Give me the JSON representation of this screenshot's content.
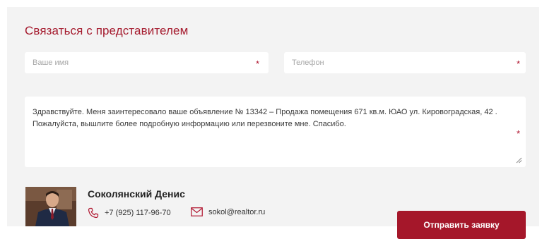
{
  "form": {
    "title": "Связаться с представителем",
    "name_placeholder": "Ваше имя",
    "phone_placeholder": "Телефон",
    "required_mark": "*",
    "message": "Здравствуйте. Меня заинтересовало ваше объявление № 13342 – Продажа помещения 671 кв.м. ЮАО ул. Кировоградская, 42 . Пожалуйста, вышлите более подробную информацию или перезвоните мне. Спасибо.",
    "submit_label": "Отправить заявку"
  },
  "agent": {
    "name": "Соколянский Денис",
    "phone": "+7 (925) 117-96-70",
    "email": "sokol@realtor.ru"
  },
  "colors": {
    "accent": "#a51b2e",
    "panel_bg": "#f3f3f3",
    "field_bg": "#ffffff"
  },
  "icons": [
    "phone-icon",
    "envelope-icon",
    "resize-handle-icon"
  ]
}
